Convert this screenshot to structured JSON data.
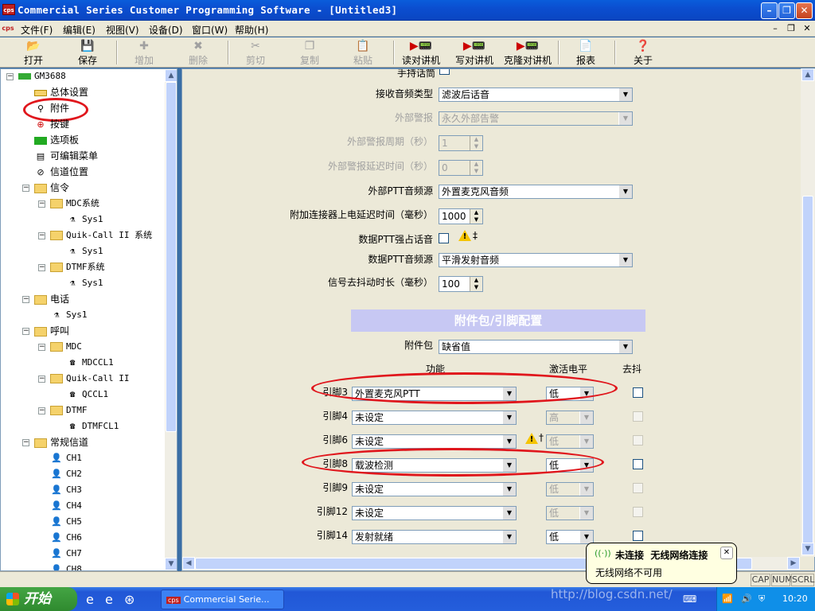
{
  "window": {
    "title": "Commercial Series Customer Programming Software - [Untitled3]",
    "app_icon_text": "cps"
  },
  "menu": [
    "文件(F)",
    "编辑(E)",
    "视图(V)",
    "设备(D)",
    "窗口(W)",
    "帮助(H)"
  ],
  "toolbar": [
    {
      "label": "打开",
      "icon": "open-icon",
      "enabled": true
    },
    {
      "label": "保存",
      "icon": "save-icon",
      "enabled": true
    },
    {
      "label": "增加",
      "icon": "add-icon",
      "enabled": false
    },
    {
      "label": "删除",
      "icon": "delete-icon",
      "enabled": false
    },
    {
      "label": "剪切",
      "icon": "cut-icon",
      "enabled": false
    },
    {
      "label": "复制",
      "icon": "copy-icon",
      "enabled": false
    },
    {
      "label": "粘贴",
      "icon": "paste-icon",
      "enabled": false
    },
    {
      "label": "读对讲机",
      "icon": "read-radio-icon",
      "enabled": true
    },
    {
      "label": "写对讲机",
      "icon": "write-radio-icon",
      "enabled": true
    },
    {
      "label": "克隆对讲机",
      "icon": "clone-radio-icon",
      "enabled": true
    },
    {
      "label": "报表",
      "icon": "report-icon",
      "enabled": true
    },
    {
      "label": "关于",
      "icon": "about-icon",
      "enabled": true
    }
  ],
  "tree": {
    "root": "GM3688",
    "items": [
      "总体设置",
      "附件",
      "按键",
      "选项板",
      "可编辑菜单",
      "信道位置",
      "信令",
      "MDC系统",
      "Sys1",
      "Quik-Call II 系统",
      "Sys1",
      "DTMF系统",
      "Sys1",
      "电话",
      "Sys1",
      "呼叫",
      "MDC",
      "MDCCL1",
      "Quik-Call II",
      "QCCL1",
      "DTMF",
      "DTMFCL1",
      "常规信道",
      "CH1",
      "CH2",
      "CH3",
      "CH4",
      "CH5",
      "CH6",
      "CH7",
      "CH8"
    ]
  },
  "form": {
    "top_partial_label": "手持话筒",
    "fields": [
      {
        "label": "接收音频类型",
        "value": "滤波后话音",
        "enabled": true,
        "kind": "combo"
      },
      {
        "label": "外部警报",
        "value": "永久外部告警",
        "enabled": false,
        "kind": "combo"
      },
      {
        "label": "外部警报周期（秒）",
        "value": "1",
        "enabled": false,
        "kind": "spin"
      },
      {
        "label": "外部警报延迟时间（秒）",
        "value": "0",
        "enabled": false,
        "kind": "spin"
      },
      {
        "label": "外部PTT音频源",
        "value": "外置麦克风音频",
        "enabled": true,
        "kind": "combo"
      },
      {
        "label": "附加连接器上电延迟时间（毫秒）",
        "value": "1000",
        "enabled": true,
        "kind": "spin"
      },
      {
        "label": "数据PTT强占话音",
        "value": "",
        "enabled": true,
        "kind": "check",
        "note": "‡"
      },
      {
        "label": "数据PTT音频源",
        "value": "平滑发射音频",
        "enabled": true,
        "kind": "combo"
      },
      {
        "label": "信号去抖动时长（毫秒）",
        "value": "100",
        "enabled": true,
        "kind": "spin"
      }
    ],
    "section_title": "附件包/引脚配置",
    "package_label": "附件包",
    "package_value": "缺省值",
    "col_function": "功能",
    "col_level": "激活电平",
    "col_debounce": "去抖",
    "pins": [
      {
        "pin": "引脚3",
        "function": "外置麦克风PTT",
        "level": "低",
        "level_enabled": true,
        "warn": false
      },
      {
        "pin": "引脚4",
        "function": "未设定",
        "level": "高",
        "level_enabled": false,
        "warn": false
      },
      {
        "pin": "引脚6",
        "function": "未设定",
        "level": "低",
        "level_enabled": false,
        "warn": true,
        "note": "†"
      },
      {
        "pin": "引脚8",
        "function": "载波检测",
        "level": "低",
        "level_enabled": true,
        "warn": false
      },
      {
        "pin": "引脚9",
        "function": "未设定",
        "level": "低",
        "level_enabled": false,
        "warn": false
      },
      {
        "pin": "引脚12",
        "function": "未设定",
        "level": "低",
        "level_enabled": false,
        "warn": false
      },
      {
        "pin": "引脚14",
        "function": "发射就绪",
        "level": "低",
        "level_enabled": true,
        "warn": false
      }
    ]
  },
  "statusbar": {
    "caps": "CAP",
    "num": "NUM",
    "scroll": "SCRL"
  },
  "taskbar": {
    "start": "开始",
    "task": "Commercial Serie...",
    "clock": "10:20"
  },
  "balloon": {
    "title": "未连接  无线网络连接",
    "body": "无线网络不可用"
  },
  "watermark": "http://blog.csdn.net/",
  "colors": {
    "highlight_oval": "#e0161c",
    "section_header": "#c7c8f3",
    "xp_blue": "#245edc"
  }
}
